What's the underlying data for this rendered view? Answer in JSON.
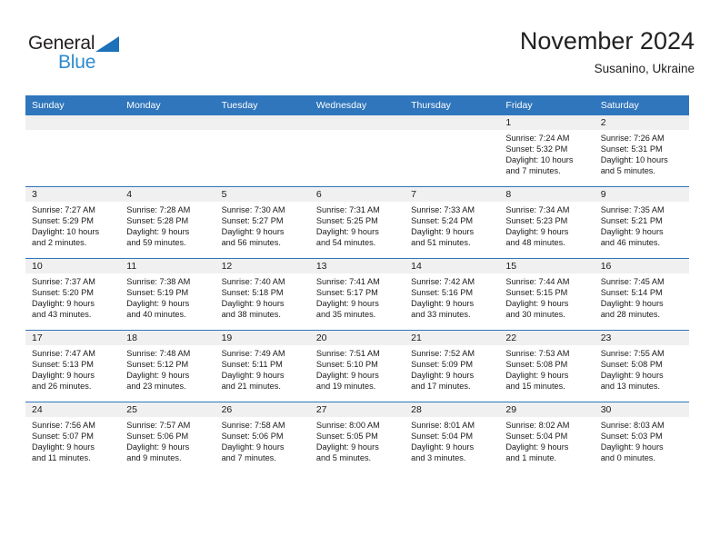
{
  "brand": {
    "name_part1": "General",
    "name_part2": "Blue",
    "accent_color": "#2e8bd0",
    "triangle_color": "#1d71b8"
  },
  "header": {
    "title": "November 2024",
    "subtitle": "Susanino, Ukraine"
  },
  "calendar": {
    "header_color": "#2f76bc",
    "daynum_band_color": "#f0f0f0",
    "weekdays": [
      "Sunday",
      "Monday",
      "Tuesday",
      "Wednesday",
      "Thursday",
      "Friday",
      "Saturday"
    ],
    "labels": {
      "sunrise": "Sunrise:",
      "sunset": "Sunset:",
      "daylight": "Daylight:"
    },
    "weeks": [
      [
        {
          "empty": true
        },
        {
          "empty": true
        },
        {
          "empty": true
        },
        {
          "empty": true
        },
        {
          "empty": true
        },
        {
          "day": "1",
          "sunrise": "Sunrise: 7:24 AM",
          "sunset": "Sunset: 5:32 PM",
          "daylight_line1": "Daylight: 10 hours",
          "daylight_line2": "and 7 minutes."
        },
        {
          "day": "2",
          "sunrise": "Sunrise: 7:26 AM",
          "sunset": "Sunset: 5:31 PM",
          "daylight_line1": "Daylight: 10 hours",
          "daylight_line2": "and 5 minutes."
        }
      ],
      [
        {
          "day": "3",
          "sunrise": "Sunrise: 7:27 AM",
          "sunset": "Sunset: 5:29 PM",
          "daylight_line1": "Daylight: 10 hours",
          "daylight_line2": "and 2 minutes."
        },
        {
          "day": "4",
          "sunrise": "Sunrise: 7:28 AM",
          "sunset": "Sunset: 5:28 PM",
          "daylight_line1": "Daylight: 9 hours",
          "daylight_line2": "and 59 minutes."
        },
        {
          "day": "5",
          "sunrise": "Sunrise: 7:30 AM",
          "sunset": "Sunset: 5:27 PM",
          "daylight_line1": "Daylight: 9 hours",
          "daylight_line2": "and 56 minutes."
        },
        {
          "day": "6",
          "sunrise": "Sunrise: 7:31 AM",
          "sunset": "Sunset: 5:25 PM",
          "daylight_line1": "Daylight: 9 hours",
          "daylight_line2": "and 54 minutes."
        },
        {
          "day": "7",
          "sunrise": "Sunrise: 7:33 AM",
          "sunset": "Sunset: 5:24 PM",
          "daylight_line1": "Daylight: 9 hours",
          "daylight_line2": "and 51 minutes."
        },
        {
          "day": "8",
          "sunrise": "Sunrise: 7:34 AM",
          "sunset": "Sunset: 5:23 PM",
          "daylight_line1": "Daylight: 9 hours",
          "daylight_line2": "and 48 minutes."
        },
        {
          "day": "9",
          "sunrise": "Sunrise: 7:35 AM",
          "sunset": "Sunset: 5:21 PM",
          "daylight_line1": "Daylight: 9 hours",
          "daylight_line2": "and 46 minutes."
        }
      ],
      [
        {
          "day": "10",
          "sunrise": "Sunrise: 7:37 AM",
          "sunset": "Sunset: 5:20 PM",
          "daylight_line1": "Daylight: 9 hours",
          "daylight_line2": "and 43 minutes."
        },
        {
          "day": "11",
          "sunrise": "Sunrise: 7:38 AM",
          "sunset": "Sunset: 5:19 PM",
          "daylight_line1": "Daylight: 9 hours",
          "daylight_line2": "and 40 minutes."
        },
        {
          "day": "12",
          "sunrise": "Sunrise: 7:40 AM",
          "sunset": "Sunset: 5:18 PM",
          "daylight_line1": "Daylight: 9 hours",
          "daylight_line2": "and 38 minutes."
        },
        {
          "day": "13",
          "sunrise": "Sunrise: 7:41 AM",
          "sunset": "Sunset: 5:17 PM",
          "daylight_line1": "Daylight: 9 hours",
          "daylight_line2": "and 35 minutes."
        },
        {
          "day": "14",
          "sunrise": "Sunrise: 7:42 AM",
          "sunset": "Sunset: 5:16 PM",
          "daylight_line1": "Daylight: 9 hours",
          "daylight_line2": "and 33 minutes."
        },
        {
          "day": "15",
          "sunrise": "Sunrise: 7:44 AM",
          "sunset": "Sunset: 5:15 PM",
          "daylight_line1": "Daylight: 9 hours",
          "daylight_line2": "and 30 minutes."
        },
        {
          "day": "16",
          "sunrise": "Sunrise: 7:45 AM",
          "sunset": "Sunset: 5:14 PM",
          "daylight_line1": "Daylight: 9 hours",
          "daylight_line2": "and 28 minutes."
        }
      ],
      [
        {
          "day": "17",
          "sunrise": "Sunrise: 7:47 AM",
          "sunset": "Sunset: 5:13 PM",
          "daylight_line1": "Daylight: 9 hours",
          "daylight_line2": "and 26 minutes."
        },
        {
          "day": "18",
          "sunrise": "Sunrise: 7:48 AM",
          "sunset": "Sunset: 5:12 PM",
          "daylight_line1": "Daylight: 9 hours",
          "daylight_line2": "and 23 minutes."
        },
        {
          "day": "19",
          "sunrise": "Sunrise: 7:49 AM",
          "sunset": "Sunset: 5:11 PM",
          "daylight_line1": "Daylight: 9 hours",
          "daylight_line2": "and 21 minutes."
        },
        {
          "day": "20",
          "sunrise": "Sunrise: 7:51 AM",
          "sunset": "Sunset: 5:10 PM",
          "daylight_line1": "Daylight: 9 hours",
          "daylight_line2": "and 19 minutes."
        },
        {
          "day": "21",
          "sunrise": "Sunrise: 7:52 AM",
          "sunset": "Sunset: 5:09 PM",
          "daylight_line1": "Daylight: 9 hours",
          "daylight_line2": "and 17 minutes."
        },
        {
          "day": "22",
          "sunrise": "Sunrise: 7:53 AM",
          "sunset": "Sunset: 5:08 PM",
          "daylight_line1": "Daylight: 9 hours",
          "daylight_line2": "and 15 minutes."
        },
        {
          "day": "23",
          "sunrise": "Sunrise: 7:55 AM",
          "sunset": "Sunset: 5:08 PM",
          "daylight_line1": "Daylight: 9 hours",
          "daylight_line2": "and 13 minutes."
        }
      ],
      [
        {
          "day": "24",
          "sunrise": "Sunrise: 7:56 AM",
          "sunset": "Sunset: 5:07 PM",
          "daylight_line1": "Daylight: 9 hours",
          "daylight_line2": "and 11 minutes."
        },
        {
          "day": "25",
          "sunrise": "Sunrise: 7:57 AM",
          "sunset": "Sunset: 5:06 PM",
          "daylight_line1": "Daylight: 9 hours",
          "daylight_line2": "and 9 minutes."
        },
        {
          "day": "26",
          "sunrise": "Sunrise: 7:58 AM",
          "sunset": "Sunset: 5:06 PM",
          "daylight_line1": "Daylight: 9 hours",
          "daylight_line2": "and 7 minutes."
        },
        {
          "day": "27",
          "sunrise": "Sunrise: 8:00 AM",
          "sunset": "Sunset: 5:05 PM",
          "daylight_line1": "Daylight: 9 hours",
          "daylight_line2": "and 5 minutes."
        },
        {
          "day": "28",
          "sunrise": "Sunrise: 8:01 AM",
          "sunset": "Sunset: 5:04 PM",
          "daylight_line1": "Daylight: 9 hours",
          "daylight_line2": "and 3 minutes."
        },
        {
          "day": "29",
          "sunrise": "Sunrise: 8:02 AM",
          "sunset": "Sunset: 5:04 PM",
          "daylight_line1": "Daylight: 9 hours",
          "daylight_line2": "and 1 minute."
        },
        {
          "day": "30",
          "sunrise": "Sunrise: 8:03 AM",
          "sunset": "Sunset: 5:03 PM",
          "daylight_line1": "Daylight: 9 hours",
          "daylight_line2": "and 0 minutes."
        }
      ]
    ]
  }
}
